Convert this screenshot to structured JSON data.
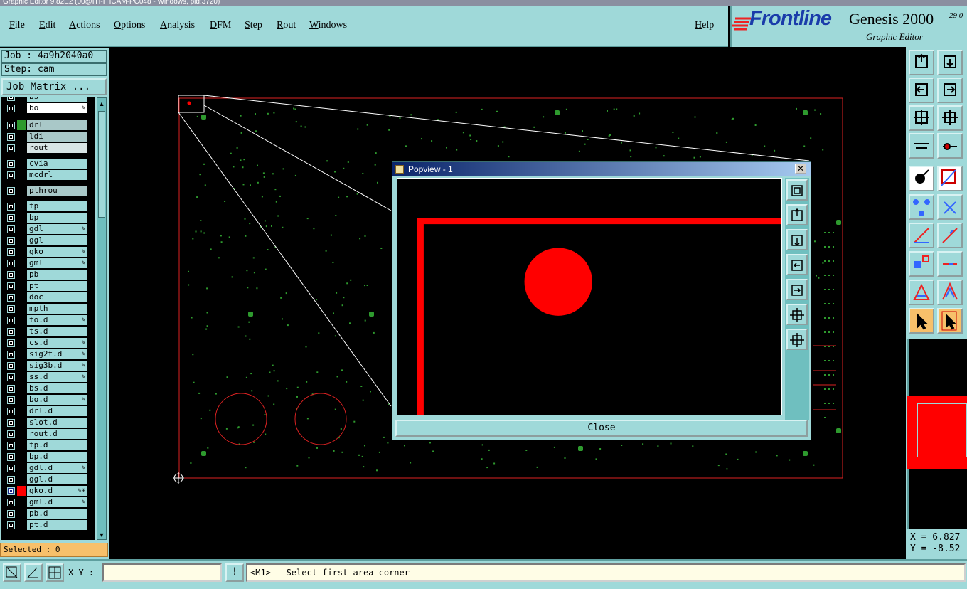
{
  "window_title": "Graphic Editor 9.82E2 (00@ITI-ITICAM-PC048 - Windows, pid:3720)",
  "menu": [
    "File",
    "Edit",
    "Actions",
    "Options",
    "Analysis",
    "DFM",
    "Step",
    "Rout",
    "Windows"
  ],
  "help_label": "Help",
  "brand": {
    "logo_text": "Frontline",
    "product": "Genesis 2000",
    "date_fragment": "29 0",
    "subtitle": "Graphic Editor"
  },
  "job_label": "Job : 4a9h2040a0",
  "step_label": "Step: cam",
  "job_matrix_button": "Job Matrix ...",
  "layers": [
    {
      "name": "bs",
      "color": "#9fd9d9",
      "side": "#000000",
      "flag": ""
    },
    {
      "name": "bo",
      "color": "#ffffff",
      "side": "#000000",
      "flag": "✎"
    },
    {
      "name": "drl",
      "color": "#a9c8c8",
      "side": "#2e9a2e",
      "flag": ""
    },
    {
      "name": "ldi",
      "color": "#a9c8c8",
      "side": "#000000",
      "flag": ""
    },
    {
      "name": "rout",
      "color": "#d8e4e4",
      "side": "#000000",
      "flag": ""
    },
    {
      "name": "cvia",
      "color": "#9fd9d9",
      "side": "#000000",
      "flag": ""
    },
    {
      "name": "mcdrl",
      "color": "#9fd9d9",
      "side": "#000000",
      "flag": ""
    },
    {
      "name": "pthrou",
      "color": "#a9c8c8",
      "side": "#000000",
      "flag": ""
    },
    {
      "name": "tp",
      "color": "#9fd9d9",
      "side": "#000000",
      "flag": ""
    },
    {
      "name": "bp",
      "color": "#9fd9d9",
      "side": "#000000",
      "flag": ""
    },
    {
      "name": "gdl",
      "color": "#9fd9d9",
      "side": "#000000",
      "flag": "✎"
    },
    {
      "name": "ggl",
      "color": "#9fd9d9",
      "side": "#000000",
      "flag": ""
    },
    {
      "name": "gko",
      "color": "#9fd9d9",
      "side": "#000000",
      "flag": "✎"
    },
    {
      "name": "gml",
      "color": "#9fd9d9",
      "side": "#000000",
      "flag": "✎"
    },
    {
      "name": "pb",
      "color": "#9fd9d9",
      "side": "#000000",
      "flag": ""
    },
    {
      "name": "pt",
      "color": "#9fd9d9",
      "side": "#000000",
      "flag": ""
    },
    {
      "name": "doc",
      "color": "#9fd9d9",
      "side": "#000000",
      "flag": ""
    },
    {
      "name": "mpth",
      "color": "#9fd9d9",
      "side": "#000000",
      "flag": ""
    },
    {
      "name": "to.d",
      "color": "#9fd9d9",
      "side": "#000000",
      "flag": "✎"
    },
    {
      "name": "ts.d",
      "color": "#9fd9d9",
      "side": "#000000",
      "flag": ""
    },
    {
      "name": "cs.d",
      "color": "#9fd9d9",
      "side": "#000000",
      "flag": "✎"
    },
    {
      "name": "sig2t.d",
      "color": "#9fd9d9",
      "side": "#000000",
      "flag": "✎"
    },
    {
      "name": "sig3b.d",
      "color": "#9fd9d9",
      "side": "#000000",
      "flag": "✎"
    },
    {
      "name": "ss.d",
      "color": "#9fd9d9",
      "side": "#000000",
      "flag": "✎"
    },
    {
      "name": "bs.d",
      "color": "#9fd9d9",
      "side": "#000000",
      "flag": ""
    },
    {
      "name": "bo.d",
      "color": "#9fd9d9",
      "side": "#000000",
      "flag": "✎"
    },
    {
      "name": "drl.d",
      "color": "#9fd9d9",
      "side": "#000000",
      "flag": ""
    },
    {
      "name": "slot.d",
      "color": "#9fd9d9",
      "side": "#000000",
      "flag": ""
    },
    {
      "name": "rout.d",
      "color": "#9fd9d9",
      "side": "#000000",
      "flag": ""
    },
    {
      "name": "tp.d",
      "color": "#9fd9d9",
      "side": "#000000",
      "flag": ""
    },
    {
      "name": "bp.d",
      "color": "#9fd9d9",
      "side": "#000000",
      "flag": ""
    },
    {
      "name": "gdl.d",
      "color": "#9fd9d9",
      "side": "#000000",
      "flag": "✎"
    },
    {
      "name": "ggl.d",
      "color": "#9fd9d9",
      "side": "#000000",
      "flag": ""
    },
    {
      "name": "gko.d",
      "color": "#9fd9d9",
      "side": "#ff0000",
      "flag": "✎⊞",
      "active": true
    },
    {
      "name": "gml.d",
      "color": "#9fd9d9",
      "side": "#000000",
      "flag": "✎"
    },
    {
      "name": "pb.d",
      "color": "#9fd9d9",
      "side": "#000000",
      "flag": ""
    },
    {
      "name": "pt.d",
      "color": "#9fd9d9",
      "side": "#000000",
      "flag": ""
    }
  ],
  "selected_label": "Selected : 0",
  "coords": {
    "x": "X =  6.827",
    "y": "Y = -8.52"
  },
  "bottom": {
    "xy_label": "X Y :",
    "xy_value": "",
    "warn_glyph": "!",
    "status": "<M1> - Select first area corner"
  },
  "popview": {
    "title": "Popview - 1",
    "close_button": "Close",
    "close_x": "✕"
  },
  "colors": {
    "panel": "#9fd9d9",
    "accent_red": "#ff0000",
    "pad_green": "#2e9a2e",
    "selected_bg": "#f7c06a"
  }
}
